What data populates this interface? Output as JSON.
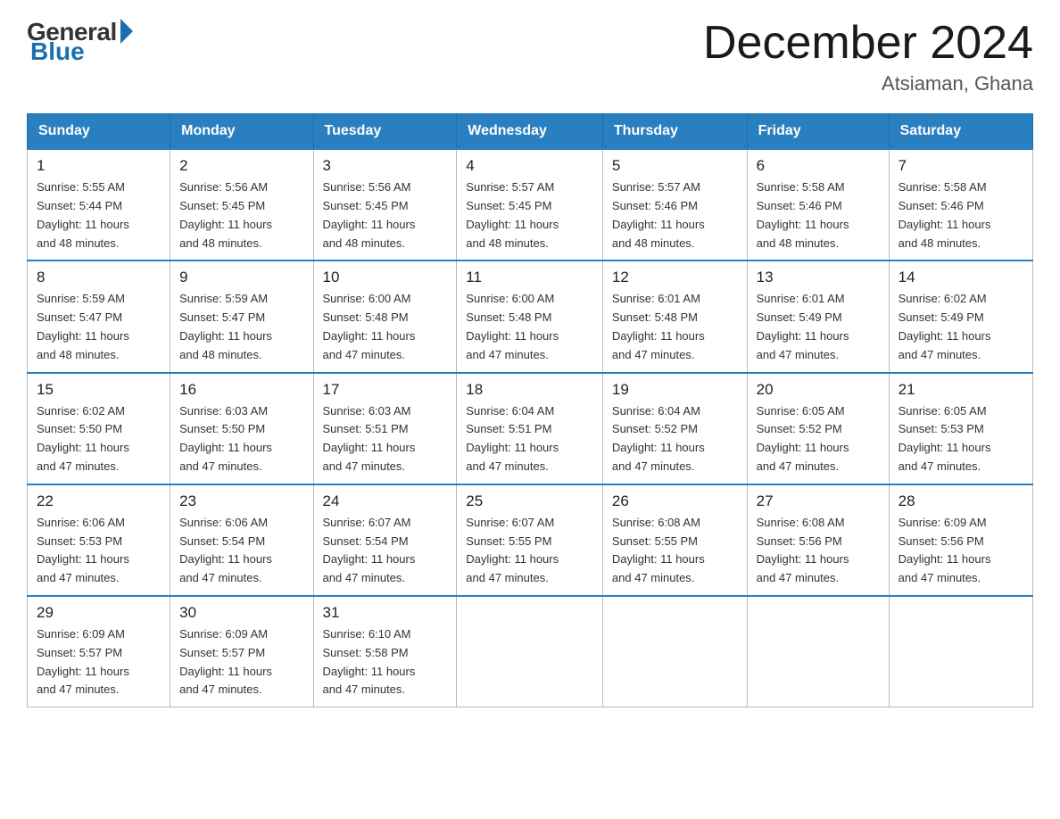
{
  "logo": {
    "general": "General",
    "blue": "Blue"
  },
  "header": {
    "month_year": "December 2024",
    "location": "Atsiaman, Ghana"
  },
  "days_of_week": [
    "Sunday",
    "Monday",
    "Tuesday",
    "Wednesday",
    "Thursday",
    "Friday",
    "Saturday"
  ],
  "weeks": [
    [
      {
        "day": "1",
        "sunrise": "5:55 AM",
        "sunset": "5:44 PM",
        "daylight": "11 hours and 48 minutes."
      },
      {
        "day": "2",
        "sunrise": "5:56 AM",
        "sunset": "5:45 PM",
        "daylight": "11 hours and 48 minutes."
      },
      {
        "day": "3",
        "sunrise": "5:56 AM",
        "sunset": "5:45 PM",
        "daylight": "11 hours and 48 minutes."
      },
      {
        "day": "4",
        "sunrise": "5:57 AM",
        "sunset": "5:45 PM",
        "daylight": "11 hours and 48 minutes."
      },
      {
        "day": "5",
        "sunrise": "5:57 AM",
        "sunset": "5:46 PM",
        "daylight": "11 hours and 48 minutes."
      },
      {
        "day": "6",
        "sunrise": "5:58 AM",
        "sunset": "5:46 PM",
        "daylight": "11 hours and 48 minutes."
      },
      {
        "day": "7",
        "sunrise": "5:58 AM",
        "sunset": "5:46 PM",
        "daylight": "11 hours and 48 minutes."
      }
    ],
    [
      {
        "day": "8",
        "sunrise": "5:59 AM",
        "sunset": "5:47 PM",
        "daylight": "11 hours and 48 minutes."
      },
      {
        "day": "9",
        "sunrise": "5:59 AM",
        "sunset": "5:47 PM",
        "daylight": "11 hours and 48 minutes."
      },
      {
        "day": "10",
        "sunrise": "6:00 AM",
        "sunset": "5:48 PM",
        "daylight": "11 hours and 47 minutes."
      },
      {
        "day": "11",
        "sunrise": "6:00 AM",
        "sunset": "5:48 PM",
        "daylight": "11 hours and 47 minutes."
      },
      {
        "day": "12",
        "sunrise": "6:01 AM",
        "sunset": "5:48 PM",
        "daylight": "11 hours and 47 minutes."
      },
      {
        "day": "13",
        "sunrise": "6:01 AM",
        "sunset": "5:49 PM",
        "daylight": "11 hours and 47 minutes."
      },
      {
        "day": "14",
        "sunrise": "6:02 AM",
        "sunset": "5:49 PM",
        "daylight": "11 hours and 47 minutes."
      }
    ],
    [
      {
        "day": "15",
        "sunrise": "6:02 AM",
        "sunset": "5:50 PM",
        "daylight": "11 hours and 47 minutes."
      },
      {
        "day": "16",
        "sunrise": "6:03 AM",
        "sunset": "5:50 PM",
        "daylight": "11 hours and 47 minutes."
      },
      {
        "day": "17",
        "sunrise": "6:03 AM",
        "sunset": "5:51 PM",
        "daylight": "11 hours and 47 minutes."
      },
      {
        "day": "18",
        "sunrise": "6:04 AM",
        "sunset": "5:51 PM",
        "daylight": "11 hours and 47 minutes."
      },
      {
        "day": "19",
        "sunrise": "6:04 AM",
        "sunset": "5:52 PM",
        "daylight": "11 hours and 47 minutes."
      },
      {
        "day": "20",
        "sunrise": "6:05 AM",
        "sunset": "5:52 PM",
        "daylight": "11 hours and 47 minutes."
      },
      {
        "day": "21",
        "sunrise": "6:05 AM",
        "sunset": "5:53 PM",
        "daylight": "11 hours and 47 minutes."
      }
    ],
    [
      {
        "day": "22",
        "sunrise": "6:06 AM",
        "sunset": "5:53 PM",
        "daylight": "11 hours and 47 minutes."
      },
      {
        "day": "23",
        "sunrise": "6:06 AM",
        "sunset": "5:54 PM",
        "daylight": "11 hours and 47 minutes."
      },
      {
        "day": "24",
        "sunrise": "6:07 AM",
        "sunset": "5:54 PM",
        "daylight": "11 hours and 47 minutes."
      },
      {
        "day": "25",
        "sunrise": "6:07 AM",
        "sunset": "5:55 PM",
        "daylight": "11 hours and 47 minutes."
      },
      {
        "day": "26",
        "sunrise": "6:08 AM",
        "sunset": "5:55 PM",
        "daylight": "11 hours and 47 minutes."
      },
      {
        "day": "27",
        "sunrise": "6:08 AM",
        "sunset": "5:56 PM",
        "daylight": "11 hours and 47 minutes."
      },
      {
        "day": "28",
        "sunrise": "6:09 AM",
        "sunset": "5:56 PM",
        "daylight": "11 hours and 47 minutes."
      }
    ],
    [
      {
        "day": "29",
        "sunrise": "6:09 AM",
        "sunset": "5:57 PM",
        "daylight": "11 hours and 47 minutes."
      },
      {
        "day": "30",
        "sunrise": "6:09 AM",
        "sunset": "5:57 PM",
        "daylight": "11 hours and 47 minutes."
      },
      {
        "day": "31",
        "sunrise": "6:10 AM",
        "sunset": "5:58 PM",
        "daylight": "11 hours and 47 minutes."
      },
      null,
      null,
      null,
      null
    ]
  ],
  "labels": {
    "sunrise": "Sunrise:",
    "sunset": "Sunset:",
    "daylight": "Daylight:"
  }
}
